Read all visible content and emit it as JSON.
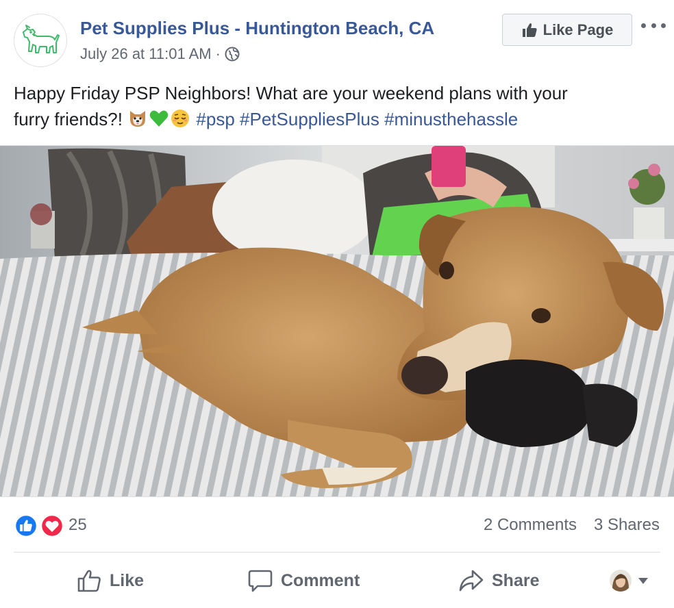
{
  "post": {
    "page_name": "Pet Supplies Plus - Huntington Beach, CA",
    "timestamp": "July 26 at 11:01 AM",
    "separator": "·",
    "privacy_icon": "globe-icon",
    "like_page_label": "Like Page",
    "more_icon": "more-options-icon",
    "text_line1": "Happy Friday PSP Neighbors! What are your weekend plans with your",
    "text_line2_prefix": "furry friends?!",
    "emojis": [
      "dog-face-emoji",
      "green-heart-emoji",
      "relieved-face-emoji"
    ],
    "hashtags": [
      "#psp",
      "#PetSuppliesPlus",
      "#minusthehassle"
    ]
  },
  "stats": {
    "reaction_count": "25",
    "reaction_icons": [
      "like-reaction-icon",
      "love-reaction-icon"
    ],
    "comments": "2 Comments",
    "shares": "3 Shares"
  },
  "actions": {
    "like": "Like",
    "comment": "Comment",
    "share": "Share"
  },
  "colors": {
    "link_blue": "#385898",
    "secondary_text": "#606770",
    "like_blue": "#1877f2",
    "love_red": "#f0284a"
  }
}
